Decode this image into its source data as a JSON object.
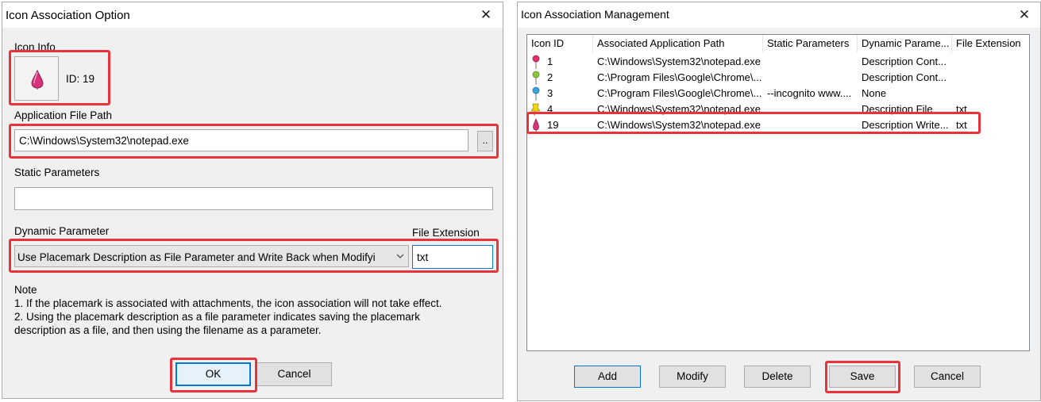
{
  "left_dialog": {
    "title": "Icon Association Option",
    "icon_info_label": "Icon Info",
    "icon_id_text": "ID: 19",
    "app_path_label": "Application File Path",
    "app_path_value": "C:\\Windows\\System32\\notepad.exe",
    "browse_label": "..",
    "static_params_label": "Static Parameters",
    "static_params_value": "",
    "dynamic_param_label": "Dynamic Parameter",
    "dynamic_param_value": "Use Placemark Description as File Parameter and Write Back when Modifyi",
    "file_ext_label": "File Extension",
    "file_ext_value": "txt",
    "note_title": "Note",
    "note_lines": [
      "1. If the placemark is associated with attachments, the icon association will not take effect.",
      "2. Using the placemark description as a file parameter indicates saving the placemark",
      "description as a file, and then using the filename as a parameter."
    ],
    "ok_label": "OK",
    "cancel_label": "Cancel"
  },
  "right_dialog": {
    "title": "Icon Association Management",
    "columns": [
      "Icon ID",
      "Associated Application Path",
      "Static Parameters",
      "Dynamic Parame...",
      "File Extension"
    ],
    "rows": [
      {
        "icon": "red-pushpin-icon",
        "icon_color": "#e0306a",
        "id": "1",
        "path": "C:\\Windows\\System32\\notepad.exe",
        "static": "",
        "dynamic": "Description Cont...",
        "ext": ""
      },
      {
        "icon": "green-pushpin-icon",
        "icon_color": "#8cc63f",
        "id": "2",
        "path": "C:\\Program Files\\Google\\Chrome\\...",
        "static": "",
        "dynamic": "Description Cont...",
        "ext": ""
      },
      {
        "icon": "blue-pushpin-icon",
        "icon_color": "#3aa6dd",
        "id": "3",
        "path": "C:\\Program Files\\Google\\Chrome\\...",
        "static": "--incognito www....",
        "dynamic": "None",
        "ext": ""
      },
      {
        "icon": "yellow-pushpin-icon",
        "icon_color": "#f2d600",
        "id": "4",
        "path": "C:\\Windows\\System32\\notepad.exe",
        "static": "",
        "dynamic": "Description File",
        "ext": "txt"
      },
      {
        "icon": "pink-placemark-icon",
        "icon_color": "#d6337a",
        "id": "19",
        "path": "C:\\Windows\\System32\\notepad.exe",
        "static": "",
        "dynamic": "Description Write...",
        "ext": "txt"
      }
    ],
    "add_label": "Add",
    "modify_label": "Modify",
    "delete_label": "Delete",
    "save_label": "Save",
    "cancel_label": "Cancel"
  },
  "colors": {
    "highlight": "#e8323c",
    "default_button_border": "#0078d7",
    "dialog_bg": "#f0f0f0"
  }
}
